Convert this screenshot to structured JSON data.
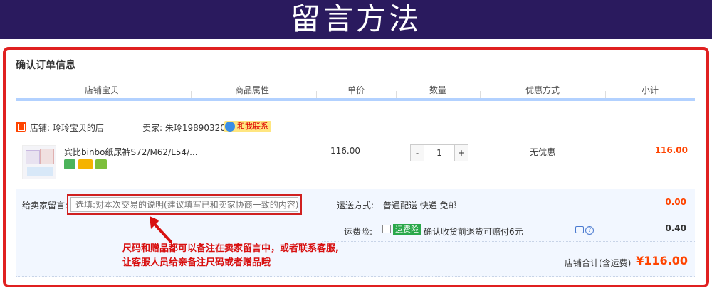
{
  "banner": {
    "title": "留言方法"
  },
  "order": {
    "title": "确认订单信息",
    "columns": [
      "店铺宝贝",
      "商品属性",
      "单价",
      "数量",
      "优惠方式",
      "小计"
    ],
    "store": {
      "label": "店铺: 玲玲宝贝的店",
      "seller": "卖家: 朱玲19890320",
      "contact": "和我联系"
    },
    "product": {
      "name": "宾比binbo纸尿裤S72/M62/L54/...",
      "price": "116.00",
      "quantity": "1",
      "minus": "-",
      "plus": "+",
      "discount": "无优惠",
      "subtotal": "116.00"
    },
    "message": {
      "label": "给卖家留言:",
      "placeholder": "选填:对本次交易的说明(建议填写已和卖家协商一致的内容)"
    },
    "shipping": {
      "label": "运送方式:",
      "value": "普通配送 快递 免邮",
      "fee": "0.00"
    },
    "insurance": {
      "label": "运费险:",
      "badge": "运费险",
      "description": "确认收货前退货可赔付6元",
      "help": "?",
      "fee": "0.40"
    },
    "total": {
      "label": "店铺合计(含运费)",
      "value": "¥116.00"
    }
  },
  "annotation": {
    "line1": "尺码和赠品都可以备注在卖家留言中，或者联系客服,",
    "line2": "让客服人员给亲备注尺码或者赠品哦"
  },
  "colors": {
    "banner": "#2a1a5e",
    "frame": "#e02020",
    "accent": "#ff4400",
    "header_bar": "#b2d1ff",
    "panel": "#f2f7ff"
  }
}
